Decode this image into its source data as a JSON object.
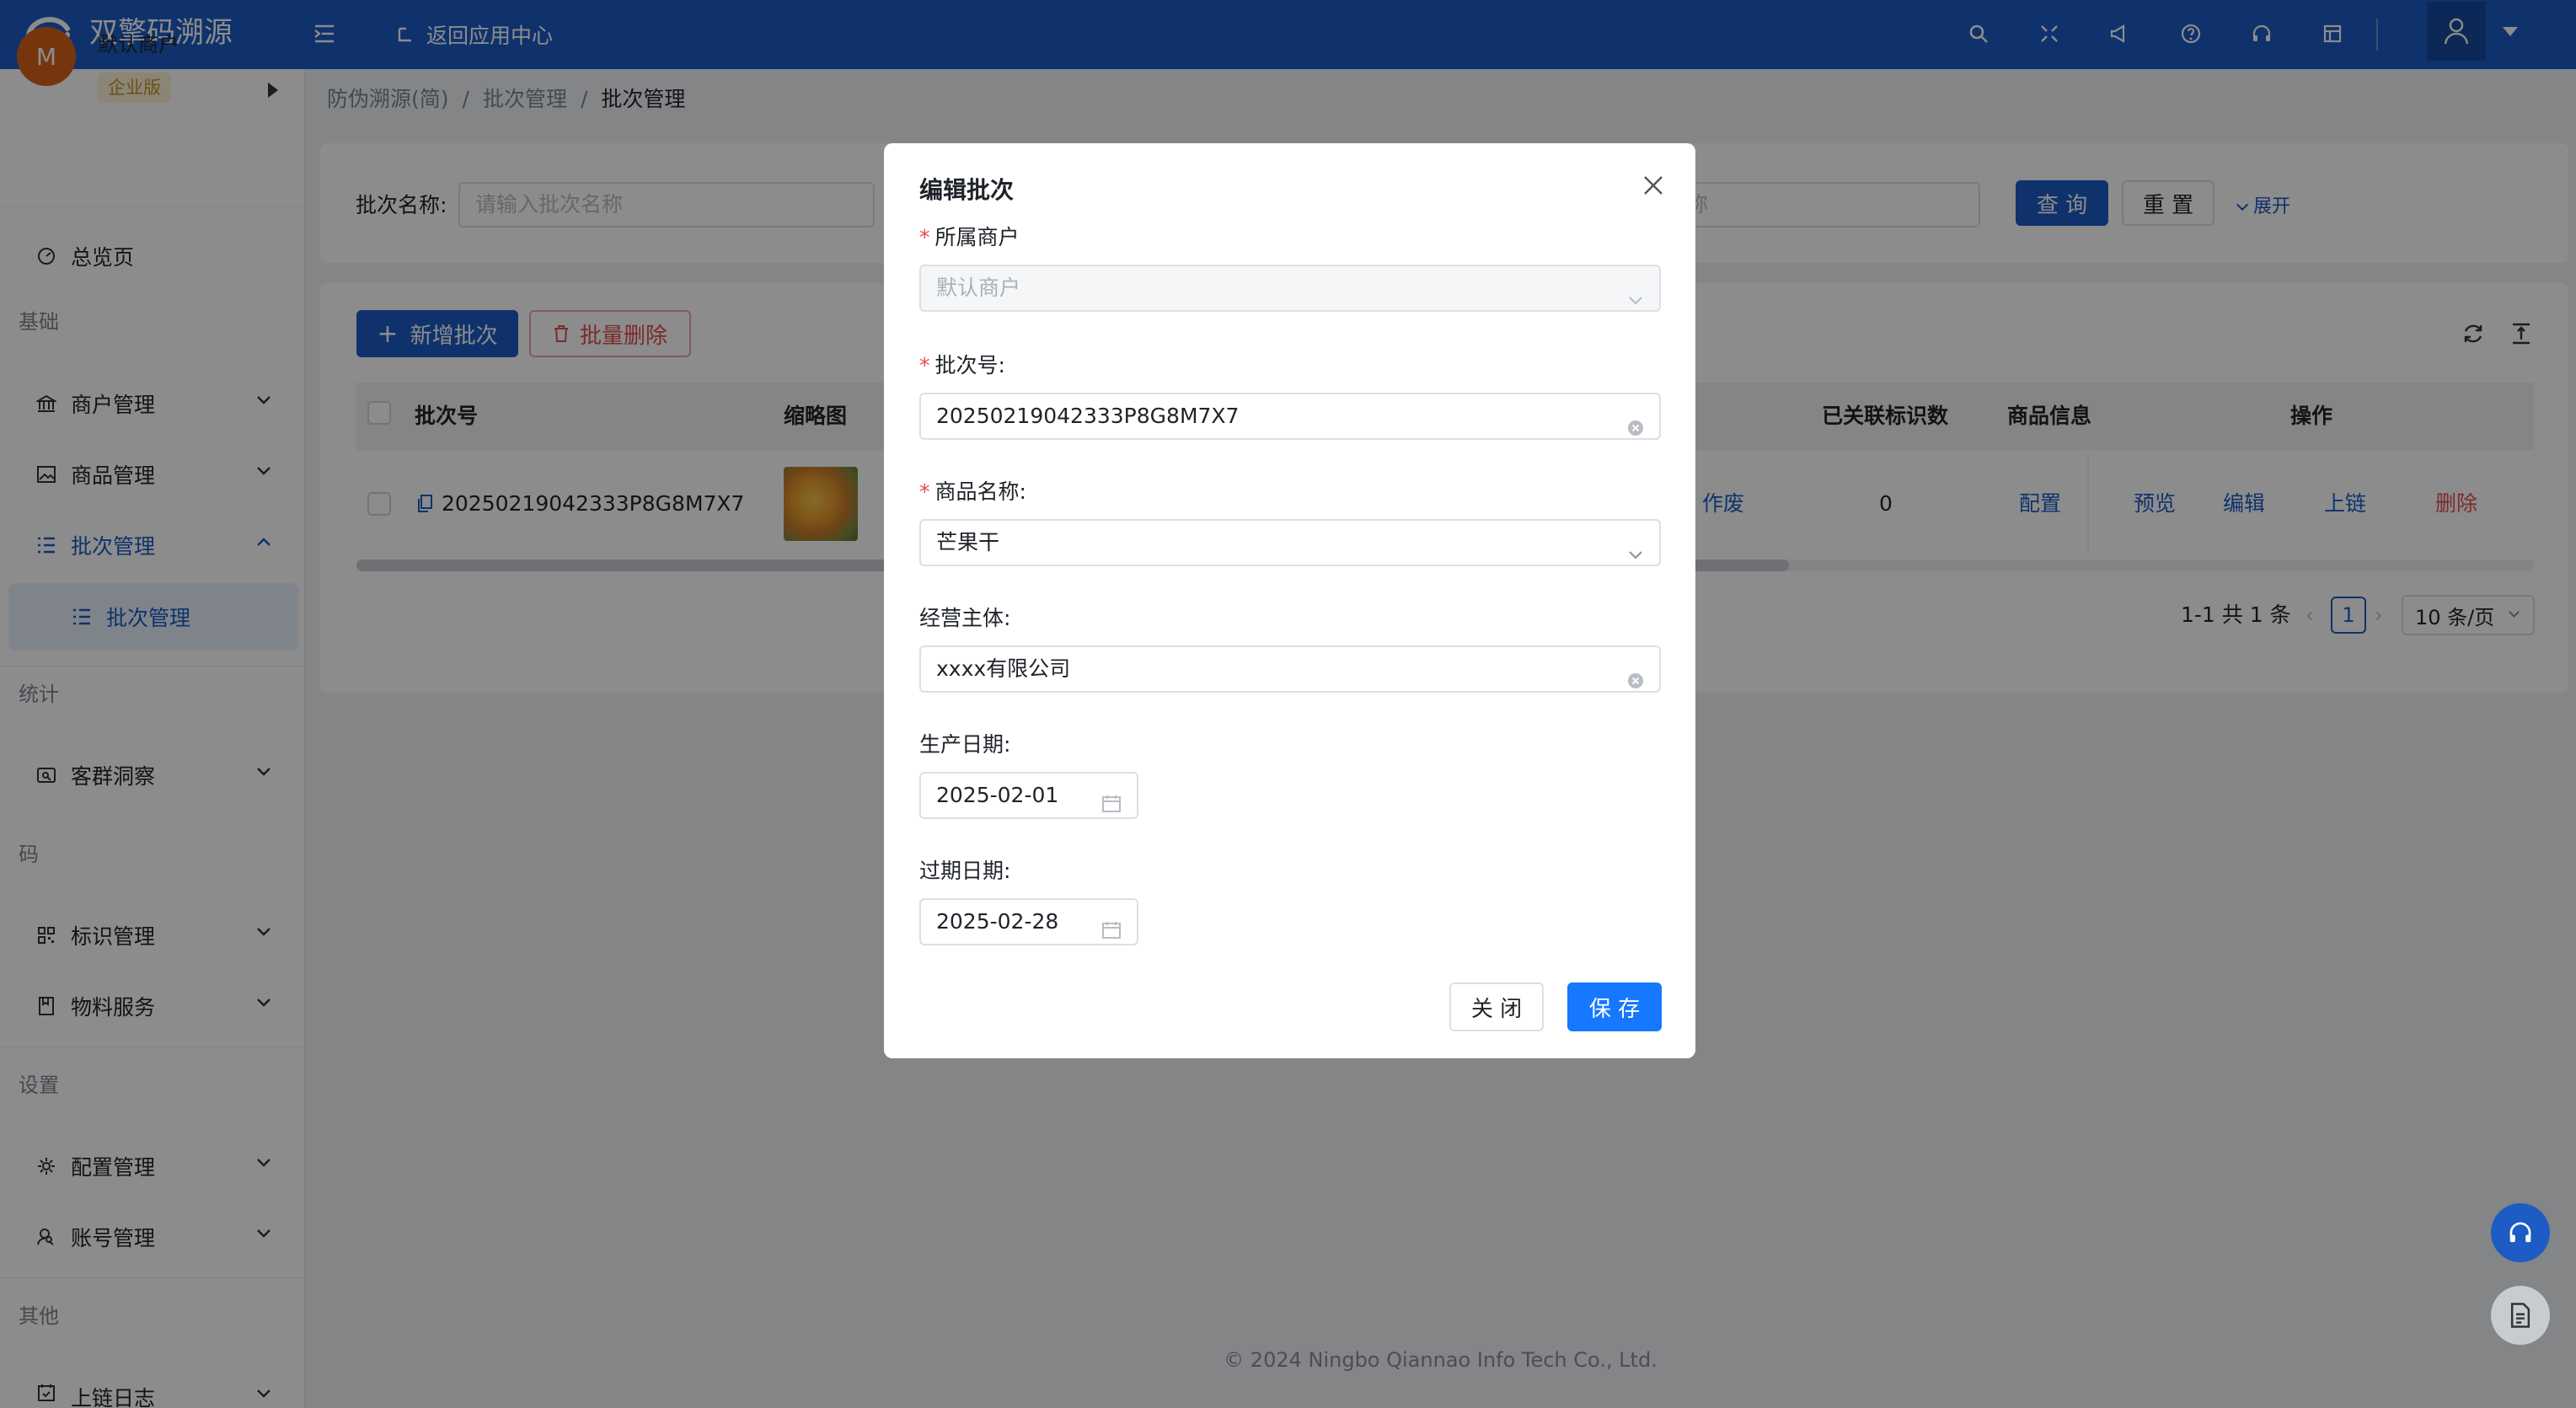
{
  "header": {
    "logo_text": "双擎码溯源",
    "back_link": "返回应用中心"
  },
  "sidebar": {
    "merchant_initial": "M",
    "merchant_name": "默认商户",
    "merchant_tag": "企业版",
    "overview": "总览页",
    "groups": {
      "basic": "基础",
      "stats": "统计",
      "code": "码",
      "settings": "设置",
      "other": "其他"
    },
    "items": {
      "merchant_mgmt": "商户管理",
      "product_mgmt": "商品管理",
      "batch_mgmt": "批次管理",
      "batch_mgmt_sub": "批次管理",
      "customer_insight": "客群洞察",
      "tag_mgmt": "标识管理",
      "material_service": "物料服务",
      "config_mgmt": "配置管理",
      "account_mgmt": "账号管理",
      "chain_log": "上链日志"
    }
  },
  "breadcrumb": [
    "防伪溯源(简)",
    "/",
    "批次管理",
    "/",
    "批次管理"
  ],
  "search": {
    "label": "批次名称:",
    "placeholder": "请输入批次名称",
    "placeholder2": "称",
    "query_btn": "查 询",
    "reset_btn": "重 置",
    "expand": "展开"
  },
  "toolbar": {
    "add_btn": "新增批次",
    "batch_delete_btn": "批量删除"
  },
  "table": {
    "columns": {
      "batch_no": "批次号",
      "thumbnail": "缩略图",
      "linked_count": "已关联标识数",
      "product_info": "商品信息",
      "actions": "操作"
    },
    "row": {
      "batch_no": "20250219042333P8G8M7X7",
      "void": "作废",
      "linked_count": "0",
      "config": "配置",
      "preview": "预览",
      "edit": "编辑",
      "chain": "上链",
      "delete": "删除"
    }
  },
  "pagination": {
    "summary": "1-1 共 1 条",
    "page": "1",
    "page_size": "10 条/页"
  },
  "footer": "© 2024 Ningbo Qiannao Info Tech Co., Ltd.",
  "modal": {
    "title": "编辑批次",
    "merchant_label": "所属商户",
    "merchant_value": "默认商户",
    "batch_no_label": "批次号:",
    "batch_no_value": "20250219042333P8G8M7X7",
    "product_label": "商品名称:",
    "product_value": "芒果干",
    "entity_label": "经营主体:",
    "entity_value": "xxxx有限公司",
    "prod_date_label": "生产日期:",
    "prod_date_value": "2025-02-01",
    "exp_date_label": "过期日期:",
    "exp_date_value": "2025-02-28",
    "close_btn": "关 闭",
    "save_btn": "保 存"
  },
  "colors": {
    "brand": "#1d5bc5",
    "primary_button": "#1677ff",
    "danger": "#e34d4d",
    "merchant_avatar": "#d9621b"
  }
}
